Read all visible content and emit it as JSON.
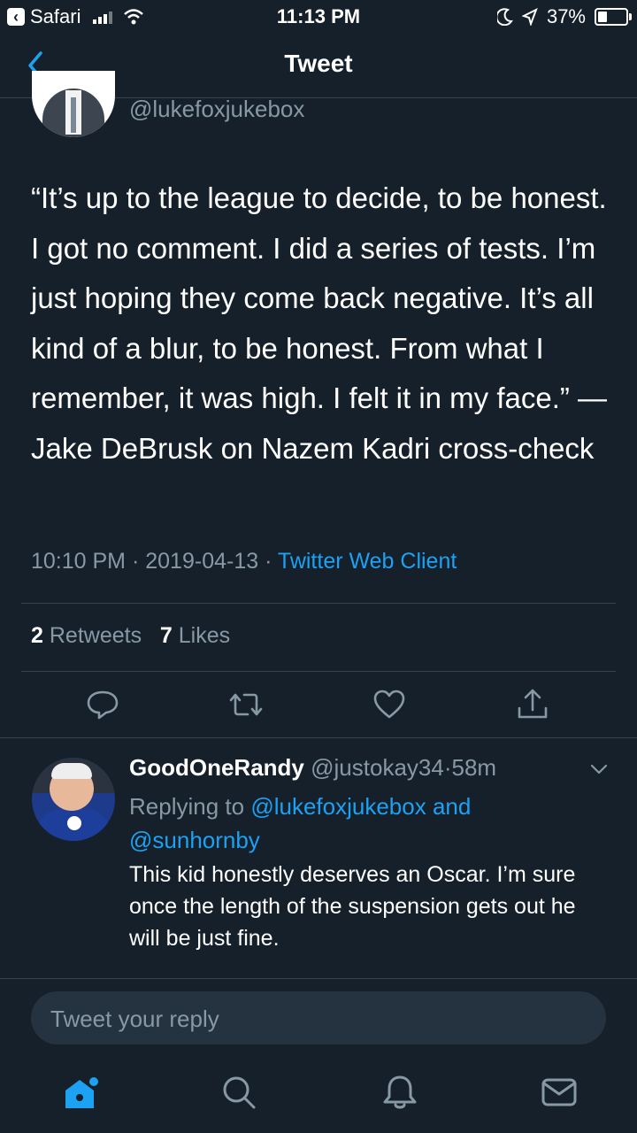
{
  "status_bar": {
    "back_app": "Safari",
    "time": "11:13 PM",
    "battery": "37%",
    "battery_level": 0.37
  },
  "nav": {
    "title": "Tweet"
  },
  "tweet": {
    "handle": "@lukefoxjukebox",
    "text": "“It’s up to the league to decide, to be honest. I got no comment. I did a series of tests. I’m just hoping they come back negative. It’s all kind of a blur, to be honest. From what I remember, it was high. I felt it in my face.” —Jake DeBrusk on Nazem Kadri cross-check",
    "time": "10:10 PM",
    "date": "2019-04-13",
    "sep": "·",
    "client": "Twitter Web Client",
    "retweets": "2",
    "retweets_label": "Retweets",
    "likes": "7",
    "likes_label": "Likes"
  },
  "reply": {
    "name": "GoodOneRandy",
    "handle": "@justokay34",
    "sep": "·",
    "age": "58m",
    "replying_prefix": "Replying to",
    "replying_user1": "@lukefoxjukebox",
    "replying_and": "and",
    "replying_user2": "@sunhornby",
    "text": "This kid honestly deserves an Oscar. I’m sure once the length of the suspension gets out he will be just fine."
  },
  "compose": {
    "placeholder": "Tweet your reply"
  },
  "colors": {
    "background": "#15202b",
    "accent": "#1da1f2",
    "secondary_text": "#8899a6",
    "divider": "#38444d"
  },
  "icons": {
    "actions": [
      "reply-icon",
      "retweet-icon",
      "like-icon",
      "share-icon"
    ],
    "tabs": [
      "home-icon",
      "search-icon",
      "notifications-icon",
      "messages-icon"
    ]
  }
}
